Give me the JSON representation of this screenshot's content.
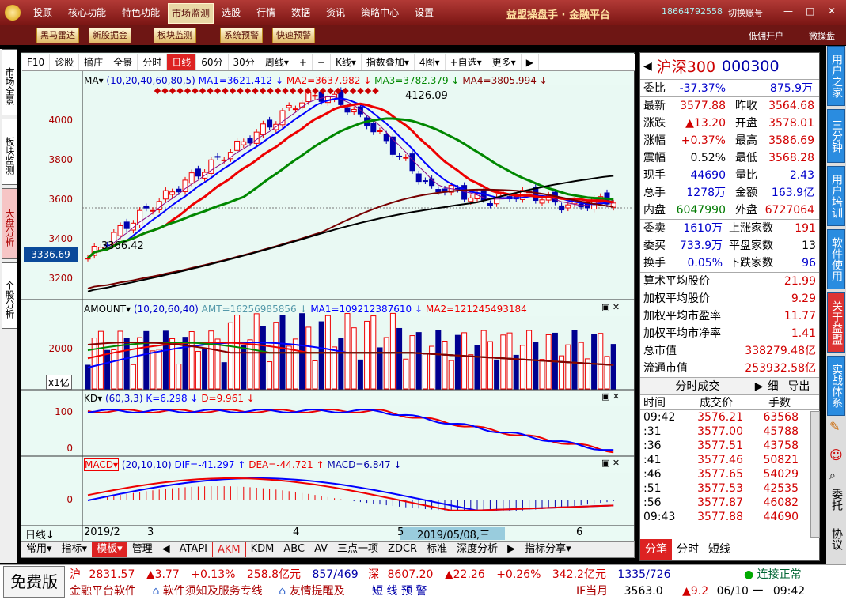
{
  "menu": [
    "投顾",
    "核心功能",
    "特色功能",
    "市场监测",
    "选股",
    "行情",
    "数据",
    "资讯",
    "策略中心",
    "设置"
  ],
  "brand": "益盟操盘手 · 金融平台",
  "phone": "18664792558",
  "switch_account": "切换账号",
  "win_min": "—",
  "win_max": "□",
  "win_close": "✕",
  "toolbar": [
    "黑马雷达",
    "新股掘金",
    "板块监测",
    "系统预警",
    "快速预警"
  ],
  "toolbar_right": [
    "低佣开户",
    "微操盘"
  ],
  "sidetabs": [
    "市场全景",
    "板块监测",
    "大盘分析",
    "个股分析"
  ],
  "chart_tools": [
    "F10",
    "诊股",
    "摘庄",
    "全景",
    "分时",
    "日线",
    "60分",
    "30分",
    "周线▾",
    "+",
    "−",
    "K线▾",
    "指数叠加▾",
    "4图▾",
    "+自选▾",
    "更多▾",
    "▶"
  ],
  "ma": {
    "label": "MA▾",
    "params": "(10,20,40,60,80,5)",
    "ma1": "MA1=3621.412 ↓",
    "ma2": "MA2=3637.982 ↓",
    "ma3": "MA3=3782.379 ↓",
    "ma4": "MA4=3805.994 ↓"
  },
  "y_main": [
    "4000",
    "3800",
    "3600",
    "3400",
    "3200"
  ],
  "marker_price": "3336.69",
  "annot_high": "4126.09",
  "annot_low": "3366.42",
  "amount": {
    "label": "AMOUNT▾",
    "params": "(10,20,60,40)",
    "amt": "AMT=16256985856 ↓",
    "ma1": "MA1=109212387610 ↓",
    "ma2": "MA2=121245493184"
  },
  "y_amount": [
    "2000"
  ],
  "unit": "x1亿",
  "kd": {
    "label": "KD▾",
    "params": "(60,3,3)",
    "k": "K=6.298 ↓",
    "d": "D=9.961 ↓"
  },
  "y_kd": [
    "100",
    "0"
  ],
  "macd": {
    "label": "MACD▾",
    "params": "(20,10,10)",
    "dif": "DIF=-41.297 ↑",
    "dea": "DEA=-44.721 ↑",
    "macd": "MACD=6.847 ↓"
  },
  "y_macd": [
    "0"
  ],
  "xaxis": {
    "label": "日线↓",
    "dates": [
      "2019/2",
      "3",
      "4",
      "5",
      "6"
    ],
    "cursor": "2019/05/08,三"
  },
  "bottom_tabs": [
    "常用▾",
    "指标▾",
    "模板▾",
    "管理",
    "◀",
    "ATAPI",
    "AKM",
    "KDM",
    "ABC",
    "AV",
    "三点一项",
    "ZDCR",
    "标准",
    "深度分析",
    "▶",
    "指标分享▾"
  ],
  "quote": {
    "name": "沪深300",
    "code": "000300",
    "wb_label": "委比",
    "wb": "-37.37%",
    "wb_amt": "875.9万",
    "rows": [
      [
        "最新",
        "3577.88",
        "昨收",
        "3564.68"
      ],
      [
        "涨跌",
        "▲13.20",
        "开盘",
        "3578.01"
      ],
      [
        "涨幅",
        "+0.37%",
        "最高",
        "3586.69"
      ],
      [
        "震幅",
        "0.52%",
        "最低",
        "3568.28"
      ],
      [
        "现手",
        "44690",
        "量比",
        "2.43"
      ],
      [
        "总手",
        "1278万",
        "金额",
        "163.9亿"
      ],
      [
        "内盘",
        "6047990",
        "外盘",
        "6727064"
      ]
    ],
    "rows2": [
      [
        "委卖",
        "1610万",
        "上涨家数",
        "191"
      ],
      [
        "委买",
        "733.9万",
        "平盘家数",
        "13"
      ],
      [
        "换手",
        "0.05%",
        "下跌家数",
        "96"
      ]
    ],
    "stats": [
      [
        "算术平均股价",
        "21.99"
      ],
      [
        "加权平均股价",
        "9.29"
      ],
      [
        "加权平均市盈率",
        "11.77"
      ],
      [
        "加权平均市净率",
        "1.41"
      ],
      [
        "总市值",
        "338279.48亿"
      ],
      [
        "流通市值",
        "253932.58亿"
      ]
    ],
    "trade_header": "分时成交",
    "trade_detail": "细",
    "trade_export": "导出",
    "trade_cols": [
      "时间",
      "成交价",
      "手数"
    ],
    "trades": [
      [
        "09:42",
        "3576.21",
        "63568"
      ],
      [
        ":31",
        "3577.00",
        "45788"
      ],
      [
        ":36",
        "3577.51",
        "43758"
      ],
      [
        ":41",
        "3577.46",
        "50821"
      ],
      [
        ":46",
        "3577.65",
        "54029"
      ],
      [
        ":51",
        "3577.53",
        "42535"
      ],
      [
        ":56",
        "3577.87",
        "46082"
      ],
      [
        "09:43",
        "3577.88",
        "44690"
      ]
    ],
    "tabs": [
      "分笔",
      "分时",
      "短线"
    ]
  },
  "rtabs": [
    "用户之家",
    "三分钟",
    "用户培训",
    "软件使用",
    "关于益盟",
    "实战体系",
    "委托",
    "协议"
  ],
  "status": {
    "free": "免费版",
    "sh_label": "沪",
    "sh": "2831.57",
    "sh_chg": "▲3.77",
    "sh_pct": "+0.13%",
    "sh_amt": "258.8亿元",
    "sh_ud": "857/469",
    "sz_label": "深",
    "sz": "8607.20",
    "sz_chg": "▲22.26",
    "sz_pct": "+0.26%",
    "sz_amt": "342.2亿元",
    "sz_ud": "1335/726",
    "conn": "连接正常",
    "news1": "金融平台软件",
    "news2": "软件须知及服务专线",
    "news3": "友情提醒及",
    "news4": "短 线 预 警",
    "if_label": "IF当月",
    "if_val": "3563.0",
    "if_chg": "▲9.2",
    "date": "06/10 一",
    "time": "09:42"
  }
}
